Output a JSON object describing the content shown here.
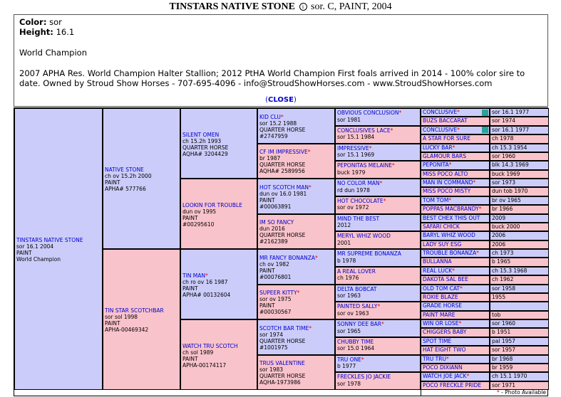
{
  "header": {
    "horse_name": "TINSTARS NATIVE STONE",
    "info_icon": "info-icon",
    "summary": "sor. C, PAINT, 2004"
  },
  "info": {
    "color_label": "Color",
    "color_value": "sor",
    "height_label": "Height",
    "height_value": "16.1",
    "title": "World Champion",
    "description": "2007 APHA Res. World Champion Halter Stallion; 2012 PtHA World Champion First foals arrived in 2014 - 100% color sire to date. Owned by Stroud Show Horses - 707-695-4096 - info@StroudShowHorses.com - www.StroudShowHorses.com",
    "close_open": "(",
    "close_label": "CLOSE",
    "close_end": ")"
  },
  "pedigree": {
    "g1": [
      {
        "name": "TINSTARS NATIVE STONE",
        "l1": "sor 16.1 2004",
        "l2": "PAINT",
        "l3": "World Champion"
      }
    ],
    "g2": [
      {
        "name": "NATIVE STONE",
        "l1": "ch ov 15.2h 2000",
        "l2": "PAINT",
        "l3": "APHA# 577766"
      },
      {
        "name": "TIN STAR SCOTCHBAR",
        "l1": "sor sol 1998",
        "l2": "PAINT",
        "l3": "APHA-00469342"
      }
    ],
    "g3": [
      {
        "name": "SILENT OMEN",
        "l1": "ch 15.2h 1993",
        "l2": "QUARTER HORSE",
        "l3": "AQHA# 3204429"
      },
      {
        "name": "LOOKIN FOR TROUBLE",
        "l1": "dun ov 1995",
        "l2": "PAINT",
        "l3": "#00295610"
      },
      {
        "name": "TIN MAN",
        "l1": "ch ro ov 16 1987",
        "l2": "PAINT",
        "l3": "APHA# 00132604"
      },
      {
        "name": "WATCH TRU SCOTCH",
        "l1": "ch sol 1989",
        "l2": "PAINT",
        "l3": "APHA-00174117"
      }
    ],
    "g4": [
      {
        "name": "KID CLU",
        "l1": "sor 15.2 1988",
        "l2": "QUARTER HORSE",
        "l3": "#2747959"
      },
      {
        "name": "CF IM IMPRESSIVE",
        "l1": "br 1987",
        "l2": "QUARTER HORSE",
        "l3": "AQHA# 2589956"
      },
      {
        "name": "HOT SCOTCH MAN",
        "l1": "dun ov 16.0 1981",
        "l2": "PAINT",
        "l3": "#00063891"
      },
      {
        "name": "IM SO FANCY",
        "l1": "dun 2016",
        "l2": "QUARTER HORSE",
        "l3": "#2162389"
      },
      {
        "name": "MR FANCY BONANZA",
        "l1": "ch ov 1982",
        "l2": "PAINT",
        "l3": "#00076801"
      },
      {
        "name": "SUPEER KITTY",
        "l1": "sor ov 1975",
        "l2": "PAINT",
        "l3": "#00030567"
      },
      {
        "name": "SCOTCH BAR TIME",
        "l1": "sor 1974",
        "l2": "QUARTER HORSE",
        "l3": "#1001975"
      },
      {
        "name": "TRUS VALENTINE",
        "l1": "sor 1983",
        "l2": "QUARTER HORSE",
        "l3": "AQHA-1973986"
      }
    ],
    "g5": [
      {
        "name": "OBVIOUS CONCLUSION",
        "l1": "sor 1981"
      },
      {
        "name": "CONCLUSIVES LACE",
        "l1": "sor 15.1 1984"
      },
      {
        "name": "IMPRESSIVE",
        "l1": "sor 15.1 1969"
      },
      {
        "name": "PEPONITAS MELAINE",
        "l1": "buck 1979"
      },
      {
        "name": "NO COLOR MAN",
        "l1": "rd dun 1978"
      },
      {
        "name": "HOT CHOCOLATE",
        "l1": "sor ov 1972"
      },
      {
        "name": "MIND THE BEST",
        "l1": "2012"
      },
      {
        "name": "MERYL WHIZ WOOD",
        "l1": "2001"
      },
      {
        "name": "MR SUPREME BONANZA",
        "l1": "b 1978"
      },
      {
        "name": "A REAL LOVER",
        "l1": "ch 1976"
      },
      {
        "name": "DELTA BOBCAT",
        "l1": "sor 1963"
      },
      {
        "name": "PAINTED SALLY",
        "l1": "sor ov 1963"
      },
      {
        "name": "SONNY DEE BAR",
        "l1": "sor 1965"
      },
      {
        "name": "CHUBBY TIME",
        "l1": "sor 15.0 1964"
      },
      {
        "name": "TRU ONE",
        "l1": "b 1977"
      },
      {
        "name": "FRECKLES JO JACKIE",
        "l1": "sor 1978"
      }
    ],
    "g6": [
      {
        "name": "CONCLUSIVE",
        "info": "sor 16.1 1977"
      },
      {
        "name": "BUZS BACCARAT",
        "info": "sor 1974"
      },
      {
        "name": "CONCLUSIVE",
        "info": "sor 16.1 1977"
      },
      {
        "name": "A STAR FOR SURE",
        "info": "ch 1978"
      },
      {
        "name": "LUCKY BAR",
        "info": "ch 15.3 1954"
      },
      {
        "name": "GLAMOUR BARS",
        "info": "sor 1960"
      },
      {
        "name": "PEPONITA",
        "info": "blk 14.3 1969"
      },
      {
        "name": "MISS POCO ALTO",
        "info": "buck 1969"
      },
      {
        "name": "MAN IN COMMAND",
        "info": "sor 1973"
      },
      {
        "name": "MISS POCO MISTY",
        "info": "dun tob 1970"
      },
      {
        "name": "TOM TOM",
        "info": "br ov 1965"
      },
      {
        "name": "POPPAS MACBRANDY",
        "info": "br 1966"
      },
      {
        "name": "BEST CHEX THIS OUT",
        "info": "2009"
      },
      {
        "name": "SAFARI CHICK",
        "info": "buck 2000"
      },
      {
        "name": "BARYL WHIZ WOOD",
        "info": "2006"
      },
      {
        "name": "LADY SUY ESG",
        "info": "2006"
      },
      {
        "name": "TROUBLE BONANZA",
        "info": "ch 1973"
      },
      {
        "name": "BULLANNA",
        "info": "b 1965"
      },
      {
        "name": "REAL LUCK",
        "info": "ch 15.3 1968"
      },
      {
        "name": "DAKOTA SAL BEE",
        "info": "ch 1962"
      },
      {
        "name": "OLD TOM CAT",
        "info": "sor 1958"
      },
      {
        "name": "ROXIE BLAZE",
        "info": "1955"
      },
      {
        "name": "GRADE HORSE",
        "info": ""
      },
      {
        "name": "PAINT MARE",
        "info": "tob"
      },
      {
        "name": "WIN OR LOSE",
        "info": "sor 1960"
      },
      {
        "name": "CHIGGERS BABY",
        "info": "b 1951"
      },
      {
        "name": "SPOT TIME",
        "info": "pal 1957"
      },
      {
        "name": "HAT EIGHT TWO",
        "info": "sor 1957"
      },
      {
        "name": "TRU TRU",
        "info": "br 1968"
      },
      {
        "name": "POCO DIXIANN",
        "info": "br 1959"
      },
      {
        "name": "WATCH JOE JACK",
        "info": "ch 15.1 1970"
      },
      {
        "name": "POCO FRECKLE PRIDE",
        "info": "sor 1971"
      }
    ]
  },
  "legend": {
    "star": "*",
    "text": " - Photo Available"
  },
  "colors": {
    "sire": "#ccccfa",
    "dam": "#f9c3cb",
    "link": "#0000cc",
    "photo_star": "#ee0000",
    "swatch": "#2aa399"
  }
}
